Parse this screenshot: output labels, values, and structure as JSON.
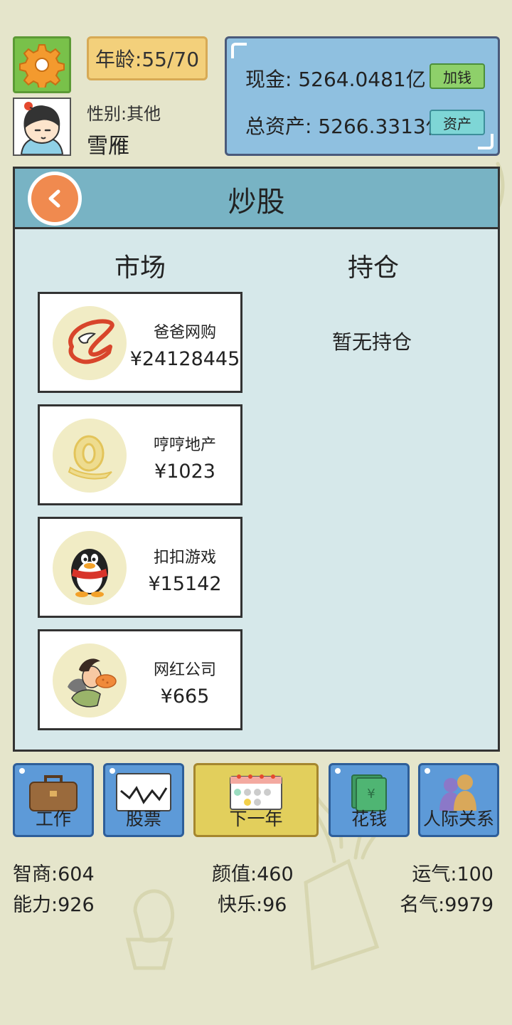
{
  "player": {
    "age_label": "年龄:55/70",
    "gender_label": "性别:其他",
    "name": "雪雁"
  },
  "finance": {
    "cash_label": "现金: 5264.0481亿",
    "total_label": "总资产: 5266.3313亿",
    "add_money_button": "加钱",
    "assets_button": "资产"
  },
  "panel": {
    "title": "炒股",
    "market_title": "市场",
    "holdings_title": "持仓",
    "no_holdings": "暂无持仓"
  },
  "stocks": [
    {
      "name": "爸爸网购",
      "price": "¥24128445",
      "icon": "shopping-logo-icon"
    },
    {
      "name": "哼哼地产",
      "price": "¥1023",
      "icon": "real-estate-logo-icon"
    },
    {
      "name": "扣扣游戏",
      "price": "¥15142",
      "icon": "penguin-logo-icon"
    },
    {
      "name": "网红公司",
      "price": "¥665",
      "icon": "influencer-logo-icon"
    }
  ],
  "nav": {
    "work": "工作",
    "stocks": "股票",
    "next_year": "下一年",
    "spend": "花钱",
    "social": "人际关系"
  },
  "stats": {
    "iq": "智商:604",
    "looks": "颜值:460",
    "luck": "运气:100",
    "ability": "能力:926",
    "happiness": "快乐:96",
    "fame": "名气:9979"
  },
  "colors": {
    "background": "#e5e5cb",
    "panel": "#d6e8ea",
    "header": "#78b3c4",
    "nav_button": "#5d9ad8",
    "next_year_button": "#e2cf5c"
  }
}
